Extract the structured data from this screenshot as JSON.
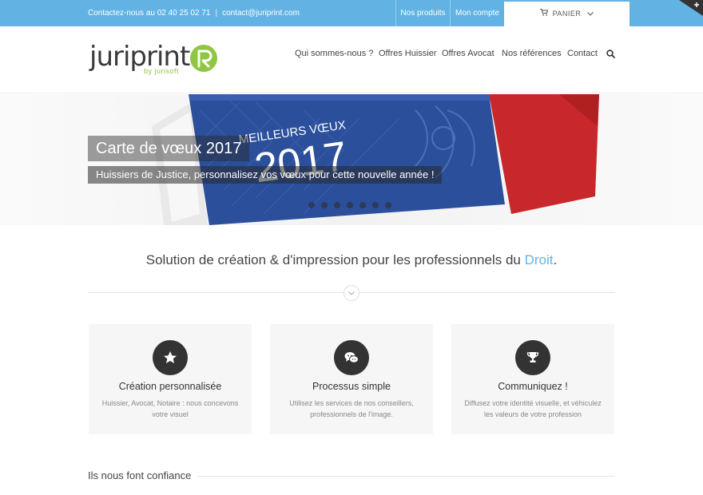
{
  "topbar": {
    "contact_phone": "Contactez-nous au 02 40 25 02 71",
    "separator": "|",
    "contact_email": "contact@juriprint.com",
    "nav_products": "Nos produits",
    "nav_account": "Mon compte",
    "cart_label": "PANIER"
  },
  "logo": {
    "name": "juriprint",
    "tagline": "by jurisoft"
  },
  "mainnav": {
    "items": [
      "Qui sommes-nous ?",
      "Offres Huissier",
      "Offres Avocat",
      "Nos références",
      "Contact"
    ]
  },
  "hero": {
    "title": "Carte de vœux 2017",
    "subtitle": "Huissiers de Justice, personnalisez vos vœux pour cette nouvelle année !",
    "card_heading": "MEILLEURS VŒUX",
    "card_year": "2017",
    "slide_count": 7
  },
  "tagline": {
    "text": "Solution de création & d'impression pour les professionnels du ",
    "highlight": "Droit",
    "end": "."
  },
  "features": [
    {
      "icon": "star-icon",
      "title": "Création personnalisée",
      "description": "Huissier, Avocat, Notaire : nous concevons votre visuel"
    },
    {
      "icon": "chat-icon",
      "title": "Processus simple",
      "description": "Utilisez les services de nos conseillers, professionnels de l'image."
    },
    {
      "icon": "trophy-icon",
      "title": "Communiquez !",
      "description": "Diffusez votre identité visuelle, et véhiculez les valeurs de votre profession"
    }
  ],
  "trust": {
    "heading": "Ils nous font confiance"
  },
  "colors": {
    "accent": "#62b3e3",
    "logo_green": "#8fc742",
    "card_blue": "#2b4f9a",
    "card_red": "#c8282b"
  }
}
